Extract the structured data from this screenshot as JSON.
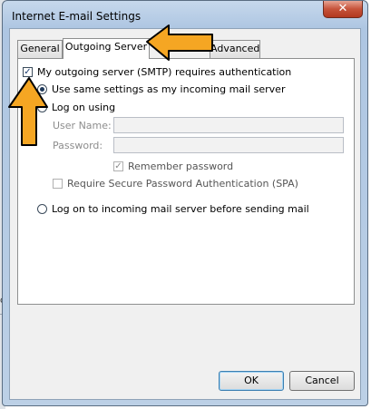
{
  "window": {
    "title": "Internet E-mail Settings",
    "close_glyph": "✕"
  },
  "background": {
    "fragment": "o"
  },
  "tabs": [
    {
      "label": "General"
    },
    {
      "label": "Outgoing Server",
      "active": true
    },
    {
      "label": "Advanced"
    }
  ],
  "outgoing": {
    "requires_auth": {
      "label": "My outgoing server (SMTP) requires authentication",
      "checked": true
    },
    "use_same": {
      "label": "Use same settings as my incoming mail server",
      "selected": true
    },
    "log_on_using": {
      "label": "Log on using",
      "selected": false
    },
    "user_name": {
      "label": "User Name:",
      "value": ""
    },
    "password": {
      "label": "Password:",
      "value": ""
    },
    "remember_password": {
      "label": "Remember password",
      "checked": true
    },
    "require_spa": {
      "label": "Require Secure Password Authentication (SPA)",
      "checked": false
    },
    "log_on_incoming": {
      "label": "Log on to incoming mail server before sending mail",
      "selected": false
    }
  },
  "buttons": {
    "ok": "OK",
    "cancel": "Cancel"
  },
  "annotations": {
    "arrow_color": "#f5a623",
    "arrow_outline": "#000000"
  }
}
